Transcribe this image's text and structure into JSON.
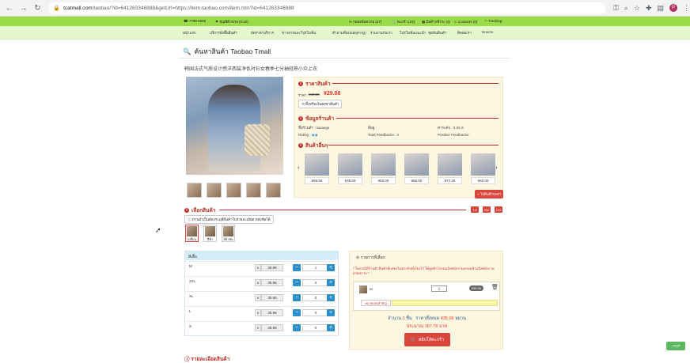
{
  "browser": {
    "url_host": "tcatmall.com",
    "url_path": "/taobao/?id=641263346888&getUrl=https://item.taobao.com/item.htm?id=641263346888"
  },
  "topbar": {
    "phone": "7788 6556",
    "account": "บัญชีค้าขาย (0.00)",
    "inbox": "กล่องข้อความ (27)",
    "cart": "ตะกร้า (23)",
    "orders": "บิลค้างชำระ (4)",
    "contact": "Contacts (0)",
    "tracking": "Tracking"
  },
  "menu": [
    "หน้าแรก",
    "บริการสั่งซื้อสินค้า",
    "อัตราค่าบริการ",
    "ข่าวสารและโปรโมชั่น",
    "คำถามที่พบบ่อย(FAQ)",
    "ร่วมงานกับเรา",
    "โปรโมชั่นแนะนำ",
    "ชุดทันสินค้า",
    "ติดต่อเรา",
    "Noocto"
  ],
  "search_title": "ค้นหาสินค้า Taobao Tmall",
  "product": {
    "title": "韩国法式气质设计感洋西装净色衬衫女春季七分袖轻熟小众上衣",
    "price_label": "ราคาสินค้า",
    "price_prefix": "ราคา :",
    "price_old": "¥49.00",
    "price_new": "¥29.88",
    "price_button": "ดิ้งหรีบเงินคงซ่าสินค้า",
    "shop_label": "ข้อมูลร้านค้า",
    "shop_name": "ชื่อร้านค้า : taoangs",
    "rating": "Rating :",
    "location": "ที่อยู่ :",
    "total_feedbacks": "Total Feedbacks : 0",
    "dsr": "ค่าระดับ : 0.00 ล",
    "positive_feedbacks": "Positive Feedbacks :",
    "similar_label": "สินค้าอื่นๆ",
    "similar_prices": [
      "¥59.50",
      "¥35.00",
      "¥53.00",
      "¥65.00",
      "¥77.40",
      "¥60.00"
    ],
    "more_button": "+ ไปสินค้าเหล่า"
  },
  "choose": {
    "label": "เลือกสินค้า",
    "hint": "ท่านจำเป็นต้องระบุสีสินค้าในรายละเอียด หลังซ้อได้",
    "langs": [
      "TH",
      "EN",
      "CN"
    ],
    "options": [
      "เปลี่ยน",
      "สีฟ้า",
      "มีผ้าพัน"
    ]
  },
  "sizes": {
    "header": "สีเสื้อ",
    "currency": "¥",
    "rows": [
      {
        "label": "M",
        "price": "35.96",
        "qty": "1"
      },
      {
        "label": "2XL",
        "price": "35.96",
        "qty": "0"
      },
      {
        "label": "XL",
        "price": "35.96",
        "qty": "0"
      },
      {
        "label": "L",
        "price": "35.96",
        "qty": "0"
      },
      {
        "label": "S",
        "price": "35.96",
        "qty": "0"
      }
    ]
  },
  "cart": {
    "header": "รายการที่เลือก",
    "note": "* ในกรณีที่ร้านค้าสินค้าที่แสดงไม่ตรงกับที่เรียงไว้ ให้ลูกค้าโปรดแจ้งพนักงานขายแล้วแจ้งพนักงานฝ่ายทราบ *",
    "item_size": "M",
    "item_qty": "1",
    "item_price": "¥35.96",
    "remark_label": "หมายเหตุสำคัญ",
    "summary_label": "จำนวน",
    "summary_qty": "1",
    "summary_unit": "ชิ้น",
    "summary_total_label": "ราคาทั้งหมด",
    "summary_total": "¥35.96",
    "summary_currency": "หยวน",
    "approx_label": "ประมาณ",
    "approx_value": "187.76",
    "approx_unit": "บาท",
    "order_button": "หยิบใส่ตะกร้า"
  },
  "bottom_heading": "รายละเอียดสินค้า",
  "top_button": "TOP"
}
